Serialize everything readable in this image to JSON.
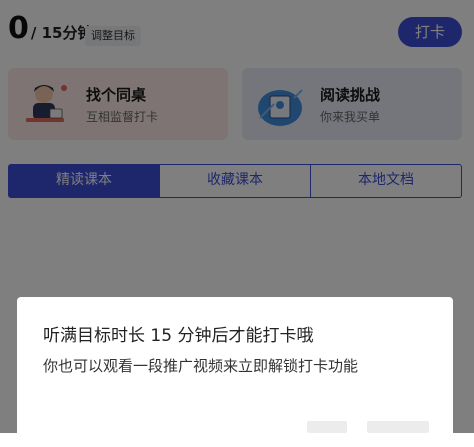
{
  "header": {
    "current_minutes": "0",
    "target_text": "/ 15分钟",
    "adjust_label": "调整目标",
    "checkin_label": "打卡"
  },
  "cards": [
    {
      "title": "找个同桌",
      "subtitle": "互相监督打卡",
      "icon": "deskmate-illustration"
    },
    {
      "title": "阅读挑战",
      "subtitle": "你来我买单",
      "icon": "reading-challenge-illustration"
    }
  ],
  "tabs": [
    {
      "label": "精读课本",
      "selected": true
    },
    {
      "label": "收藏课本",
      "selected": false
    },
    {
      "label": "本地文档",
      "selected": false
    }
  ],
  "dialog": {
    "line1": "听满目标时长 15 分钟后才能打卡哦",
    "line2": "你也可以观看一段推广视频来立即解锁打卡功能"
  },
  "colors": {
    "accent": "#3d4fd6",
    "card_left_bg": "#fde9e7",
    "card_right_bg": "#e9edf8"
  }
}
